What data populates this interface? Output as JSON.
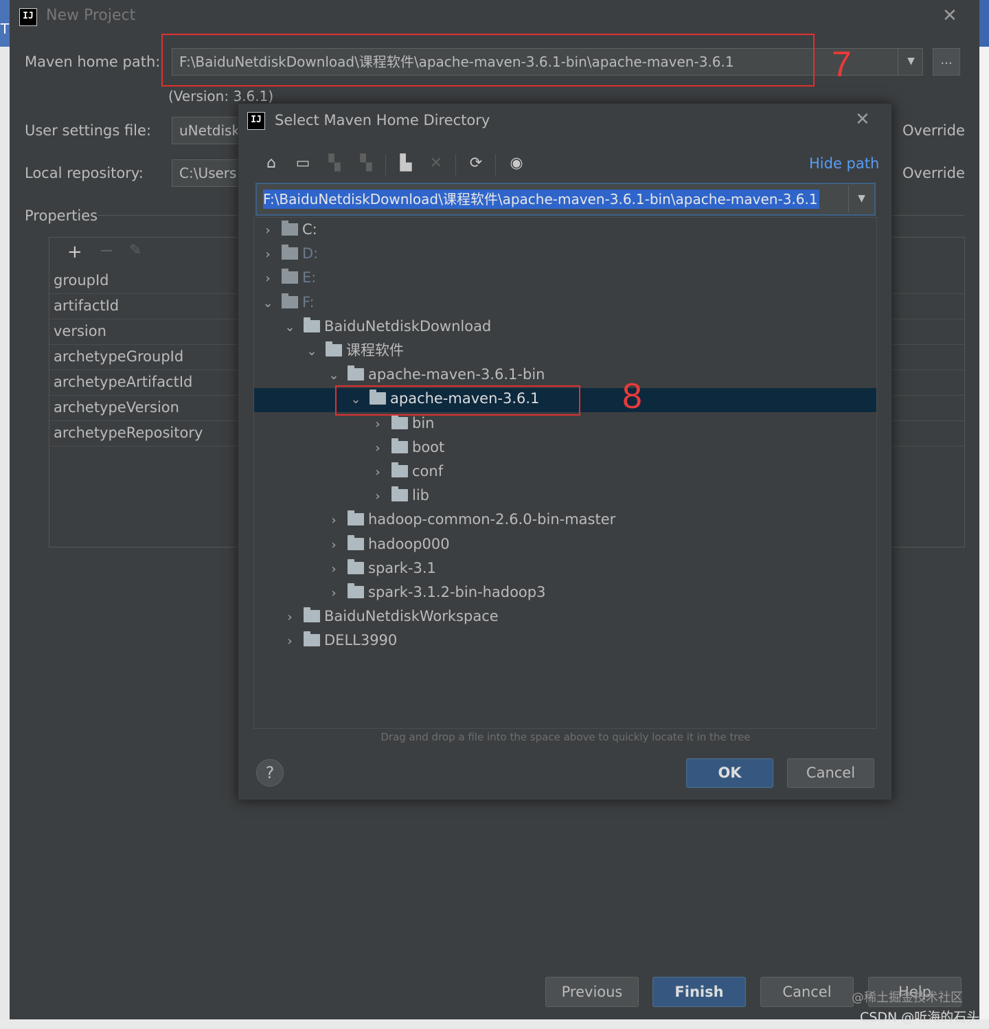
{
  "window": {
    "title": "New Project",
    "maven_home": {
      "label": "Maven home path:",
      "value": "F:\\BaiduNetdiskDownload\\课程软件\\apache-maven-3.6.1-bin\\apache-maven-3.6.1",
      "version": "(Version: 3.6.1)",
      "browse_label": "..."
    },
    "user_settings": {
      "label": "User settings file:",
      "value": "uNetdisk",
      "override": "Override"
    },
    "local_repo": {
      "label": "Local repository:",
      "value": "C:\\Users",
      "override": "Override"
    },
    "properties": {
      "label": "Properties",
      "rows": [
        "groupId",
        "artifactId",
        "version",
        "archetypeGroupId",
        "archetypeArtifactId",
        "archetypeVersion",
        "archetypeRepository"
      ]
    },
    "buttons": {
      "previous": "Previous",
      "finish": "Finish",
      "cancel": "Cancel",
      "help": "Help"
    }
  },
  "annotations": {
    "seven": "7",
    "eight": "8"
  },
  "dialog": {
    "title": "Select Maven Home Directory",
    "hide_path": "Hide path",
    "path_value": "F:\\BaiduNetdiskDownload\\课程软件\\apache-maven-3.6.1-bin\\apache-maven-3.6.1",
    "tree": [
      {
        "label": "C:",
        "expanded": false,
        "kind": "drive",
        "dim": false
      },
      {
        "label": "D:",
        "expanded": false,
        "kind": "drive",
        "dim": true
      },
      {
        "label": "E:",
        "expanded": false,
        "kind": "drive",
        "dim": true
      },
      {
        "label": "F:",
        "expanded": true,
        "kind": "drive",
        "dim": true
      },
      {
        "label": "BaiduNetdiskDownload",
        "expanded": true,
        "kind": "folder"
      },
      {
        "label": "课程软件",
        "expanded": true,
        "kind": "folder"
      },
      {
        "label": "apache-maven-3.6.1-bin",
        "expanded": true,
        "kind": "folder"
      },
      {
        "label": "apache-maven-3.6.1",
        "expanded": true,
        "kind": "folder",
        "selected": true
      },
      {
        "label": "bin",
        "expanded": false,
        "kind": "folder"
      },
      {
        "label": "boot",
        "expanded": false,
        "kind": "folder"
      },
      {
        "label": "conf",
        "expanded": false,
        "kind": "folder"
      },
      {
        "label": "lib",
        "expanded": false,
        "kind": "folder"
      },
      {
        "label": "hadoop-common-2.6.0-bin-master",
        "expanded": false,
        "kind": "folder"
      },
      {
        "label": "hadoop000",
        "expanded": false,
        "kind": "folder"
      },
      {
        "label": "spark-3.1",
        "expanded": false,
        "kind": "folder"
      },
      {
        "label": "spark-3.1.2-bin-hadoop3",
        "expanded": false,
        "kind": "folder"
      },
      {
        "label": "BaiduNetdiskWorkspace",
        "expanded": false,
        "kind": "folder"
      },
      {
        "label": "DELL3990",
        "expanded": false,
        "kind": "folder"
      }
    ],
    "hint": "Drag and drop a file into the space above to quickly locate it in the tree",
    "ok": "OK",
    "cancel": "Cancel",
    "help": "?"
  },
  "watermark": {
    "line1": "@稀土掘金技术社区",
    "line2": "CSDN @听海的石头"
  },
  "colors": {
    "accent": "#589df6",
    "annotation": "#e03030",
    "selection": "#0d293e",
    "primary_button": "#365880"
  }
}
